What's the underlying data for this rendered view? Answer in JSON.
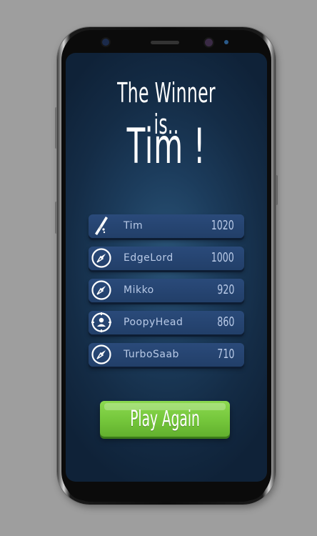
{
  "screen": {
    "heading": "The Winner is..",
    "winner": "Tim !"
  },
  "leaderboard": [
    {
      "name": "Tim",
      "score": "1020",
      "icon": "knife-icon"
    },
    {
      "name": "EdgeLord",
      "score": "1000",
      "icon": "compass-icon"
    },
    {
      "name": "Mikko",
      "score": "920",
      "icon": "compass-icon"
    },
    {
      "name": "PoopyHead",
      "score": "860",
      "icon": "person-target-icon"
    },
    {
      "name": "TurboSaab",
      "score": "710",
      "icon": "compass-icon"
    }
  ],
  "actions": {
    "play_again": "Play Again"
  },
  "colors": {
    "background": "#9e9e9e",
    "screen_bg": "#1c3c5c",
    "row_bg": "#2a4a7a",
    "row_text": "#b8c9e6",
    "button": "#74c63b"
  }
}
